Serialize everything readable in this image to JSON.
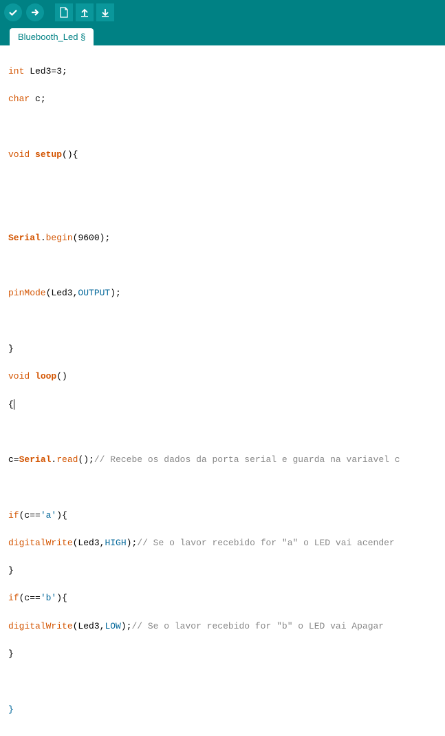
{
  "tab": {
    "label": "Bluebooth_Led §"
  },
  "code": {
    "l1_a": "int",
    "l1_b": " Led3=3;",
    "l2_a": "char",
    "l2_b": " c;",
    "l3_a": "void",
    "l3_b": " ",
    "l3_c": "setup",
    "l3_d": "(){",
    "l4_a": "Serial",
    "l4_b": ".",
    "l4_c": "begin",
    "l4_d": "(9600);",
    "l5_a": "pinMode",
    "l5_b": "(Led3,",
    "l5_c": "OUTPUT",
    "l5_d": ");",
    "l6": "}",
    "l7_a": "void",
    "l7_b": " ",
    "l7_c": "loop",
    "l7_d": "()",
    "l8": "{",
    "l9_a": "c=",
    "l9_b": "Serial",
    "l9_c": ".",
    "l9_d": "read",
    "l9_e": "();",
    "l9_f": "// Recebe os dados da porta serial e guarda na variavel c",
    "l10_a": "if",
    "l10_b": "(c==",
    "l10_c": "'a'",
    "l10_d": "){",
    "l11_a": "digitalWrite",
    "l11_b": "(Led3,",
    "l11_c": "HIGH",
    "l11_d": ");",
    "l11_e": "// Se o lavor recebido for \"a\" o LED vai acender",
    "l12": "}",
    "l13_a": "if",
    "l13_b": "(c==",
    "l13_c": "'b'",
    "l13_d": "){",
    "l14_a": "digitalWrite",
    "l14_b": "(Led3,",
    "l14_c": "LOW",
    "l14_d": ");",
    "l14_e": "// Se o lavor recebido for \"b\" o LED vai Apagar",
    "l15": "}",
    "l16": "}"
  }
}
